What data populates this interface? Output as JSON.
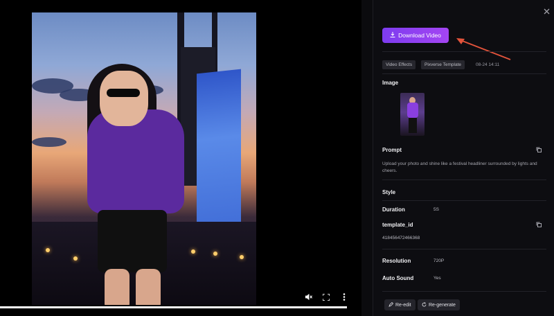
{
  "player": {
    "mute_icon": "mute-icon",
    "fullscreen_icon": "fullscreen-icon",
    "more_icon": "more-vertical-icon",
    "progress": 1.0
  },
  "panel": {
    "download_label": "Download Video",
    "tags": [
      "Video Effects",
      "Pixverse Template"
    ],
    "timestamp": "08-24 14:11",
    "image_label": "Image",
    "prompt_label": "Prompt",
    "prompt_text": "Upload your photo and shine like a festival headliner surrounded by lights and cheers.",
    "style_label": "Style",
    "duration_label": "Duration",
    "duration_value": "5S",
    "template_id_label": "template_id",
    "template_id_value": "418456472466368",
    "resolution_label": "Resolution",
    "resolution_value": "720P",
    "auto_sound_label": "Auto Sound",
    "auto_sound_value": "Yes",
    "re_edit_label": "Re-edit",
    "regenerate_label": "Re-generate"
  },
  "colors": {
    "accent_start": "#7d3cf0",
    "accent_end": "#a445f2",
    "annotation_arrow": "#e2533b"
  }
}
